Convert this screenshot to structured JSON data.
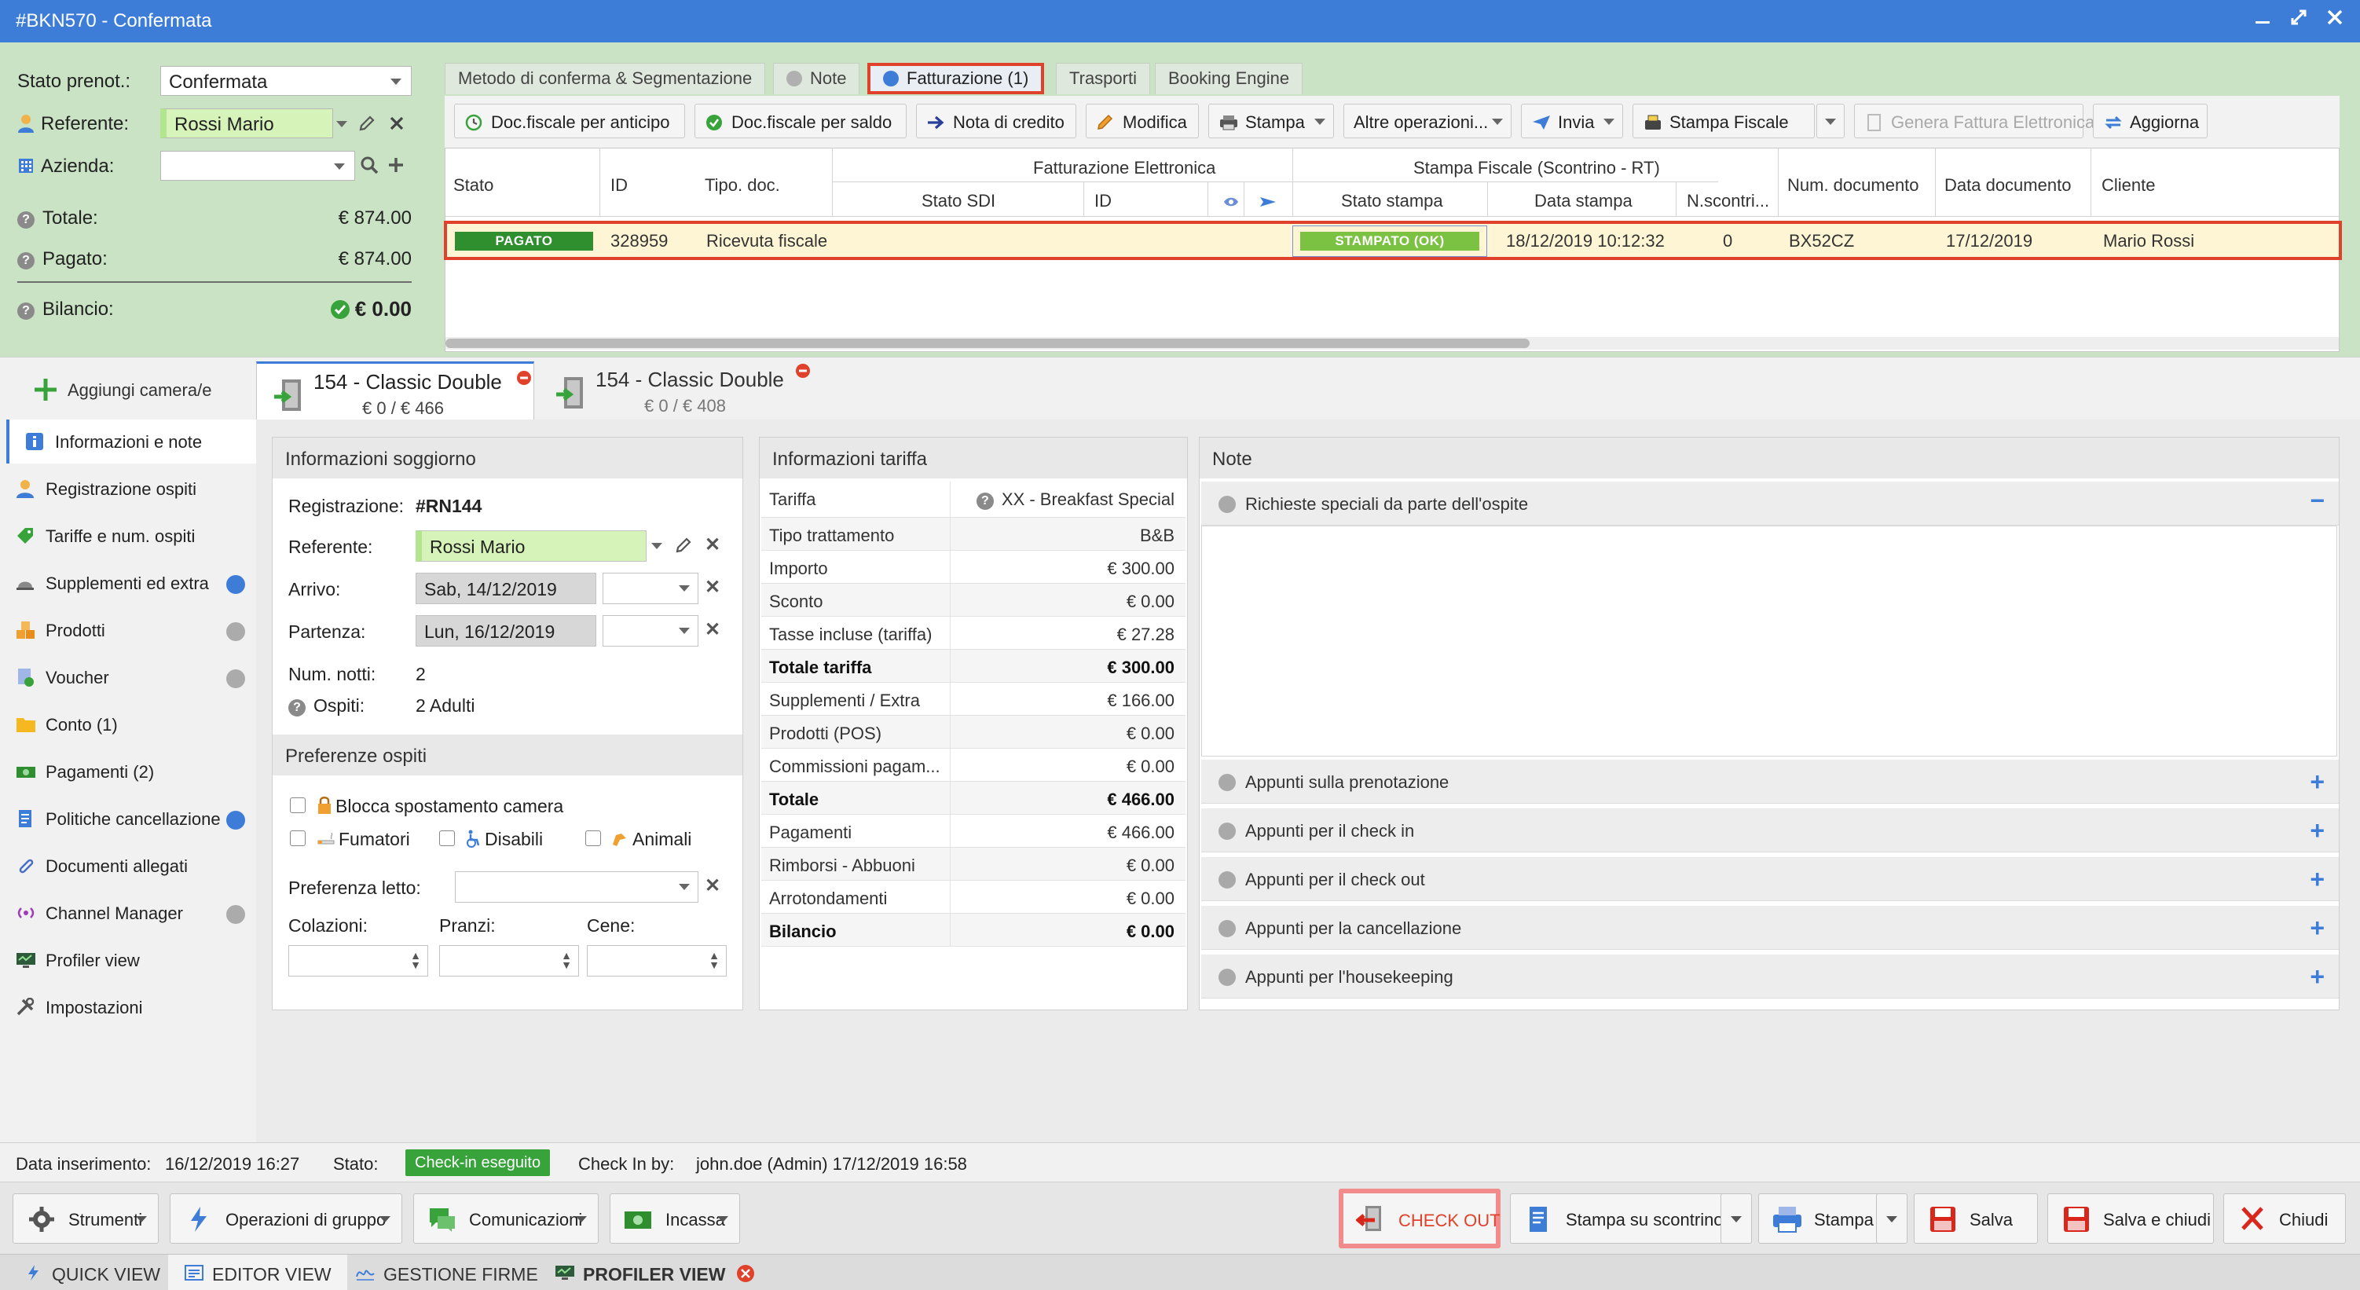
{
  "window": {
    "title": "#BKN570 - Confermata"
  },
  "header": {
    "stato_label": "Stato prenot.:",
    "stato_value": "Confermata",
    "referente_label": "Referente:",
    "referente_value": "Rossi Mario",
    "azienda_label": "Azienda:",
    "azienda_value": "",
    "totale_label": "Totale:",
    "totale_value": "€ 874.00",
    "pagato_label": "Pagato:",
    "pagato_value": "€ 874.00",
    "bilancio_label": "Bilancio:",
    "bilancio_value": "€ 0.00"
  },
  "top_tabs": [
    {
      "label": "Metodo di conferma & Segmentazione"
    },
    {
      "label": "Note"
    },
    {
      "label": "Fatturazione (1)"
    },
    {
      "label": "Trasporti"
    },
    {
      "label": "Booking Engine"
    }
  ],
  "toolbar": {
    "doc_anticipo": "Doc.fiscale per anticipo",
    "doc_saldo": "Doc.fiscale per saldo",
    "nota_credito": "Nota di credito",
    "modifica": "Modifica",
    "stampa": "Stampa",
    "altre": "Altre operazioni...",
    "invia": "Invia",
    "stampa_fiscale": "Stampa Fiscale",
    "genera_fattura": "Genera Fattura Elettronica",
    "aggiorna": "Aggiorna"
  },
  "grid": {
    "group_fe": "Fatturazione Elettronica",
    "group_sf": "Stampa Fiscale (Scontrino - RT)",
    "col_stato": "Stato",
    "col_id": "ID",
    "col_tipo": "Tipo. doc.",
    "col_sdi": "Stato SDI",
    "col_fe_id": "ID",
    "col_stato_stampa": "Stato stampa",
    "col_data_stampa": "Data stampa",
    "col_nscontri": "N.scontri...",
    "col_num_doc": "Num. documento",
    "col_data_doc": "Data documento",
    "col_cliente": "Cliente",
    "row": {
      "stato": "PAGATO",
      "id": "328959",
      "tipo": "Ricevuta fiscale",
      "stato_stampa": "STAMPATO (OK)",
      "data_stampa": "18/12/2019 10:12:32",
      "nscontri": "0",
      "num_doc": "BX52CZ",
      "data_doc": "17/12/2019",
      "cliente": "Mario Rossi"
    }
  },
  "rooms": {
    "add_label": "Aggiungi camera/e",
    "tabs": [
      {
        "name": "154 - Classic Double",
        "amount": "€ 0 / € 466"
      },
      {
        "name": "154 - Classic Double",
        "amount": "€ 0 / € 408"
      }
    ]
  },
  "sidenav": [
    {
      "label": "Informazioni e note"
    },
    {
      "label": "Registrazione ospiti"
    },
    {
      "label": "Tariffe e num. ospiti"
    },
    {
      "label": "Supplementi ed extra"
    },
    {
      "label": "Prodotti"
    },
    {
      "label": "Voucher"
    },
    {
      "label": "Conto (1)"
    },
    {
      "label": "Pagamenti (2)"
    },
    {
      "label": "Politiche cancellazione"
    },
    {
      "label": "Documenti allegati"
    },
    {
      "label": "Channel Manager"
    },
    {
      "label": "Profiler view"
    },
    {
      "label": "Impostazioni"
    }
  ],
  "soggiorno": {
    "title": "Informazioni soggiorno",
    "registrazione_label": "Registrazione:",
    "registrazione_value": "#RN144",
    "referente_label": "Referente:",
    "referente_value": "Rossi Mario",
    "arrivo_label": "Arrivo:",
    "arrivo_value": "Sab, 14/12/2019",
    "partenza_label": "Partenza:",
    "partenza_value": "Lun, 16/12/2019",
    "notti_label": "Num. notti:",
    "notti_value": "2",
    "ospiti_label": "Ospiti:",
    "ospiti_value": "2 Adulti",
    "pref_title": "Preferenze ospiti",
    "blocca": "Blocca spostamento camera",
    "fumatori": "Fumatori",
    "disabili": "Disabili",
    "animali": "Animali",
    "letto_label": "Preferenza letto:",
    "colazioni_label": "Colazioni:",
    "pranzi_label": "Pranzi:",
    "cene_label": "Cene:"
  },
  "tariffa": {
    "title": "Informazioni tariffa",
    "rows": [
      {
        "k": "Tariffa",
        "v": "XX - Breakfast Special"
      },
      {
        "k": "Tipo trattamento",
        "v": "B&B"
      },
      {
        "k": "Importo",
        "v": "€ 300.00"
      },
      {
        "k": "Sconto",
        "v": "€ 0.00"
      },
      {
        "k": "Tasse incluse (tariffa)",
        "v": "€ 27.28"
      },
      {
        "k": "Totale tariffa",
        "v": "€ 300.00"
      },
      {
        "k": "Supplementi / Extra",
        "v": "€ 166.00"
      },
      {
        "k": "Prodotti (POS)",
        "v": "€ 0.00"
      },
      {
        "k": "Commissioni pagam...",
        "v": "€ 0.00"
      },
      {
        "k": "Totale",
        "v": "€ 466.00"
      },
      {
        "k": "Pagamenti",
        "v": "€ 466.00"
      },
      {
        "k": "Rimborsi - Abbuoni",
        "v": "€ 0.00"
      },
      {
        "k": "Arrotondamenti",
        "v": "€ 0.00"
      },
      {
        "k": "Bilancio",
        "v": "€ 0.00"
      }
    ]
  },
  "note": {
    "title": "Note",
    "richieste": "Richieste speciali da parte dell'ospite",
    "sections": [
      {
        "label": "Appunti sulla prenotazione"
      },
      {
        "label": "Appunti per il check in"
      },
      {
        "label": "Appunti per il check out"
      },
      {
        "label": "Appunti per la cancellazione"
      },
      {
        "label": "Appunti per l'housekeeping"
      }
    ]
  },
  "status": {
    "inserimento_label": "Data inserimento:",
    "inserimento_value": "16/12/2019 16:27",
    "stato_label": "Stato:",
    "stato_value": "Check-in eseguito",
    "checkin_label": "Check In by:",
    "checkin_value": "john.doe (Admin) 17/12/2019 16:58"
  },
  "actions": {
    "strumenti": "Strumenti",
    "operazioni": "Operazioni di gruppo",
    "comunicazioni": "Comunicazioni",
    "incassa": "Incassa",
    "checkout": "CHECK OUT",
    "stampa_scontrino": "Stampa su scontrino",
    "stampa": "Stampa",
    "salva": "Salva",
    "salva_chiudi": "Salva e chiudi",
    "chiudi": "Chiudi"
  },
  "bottom_tabs": [
    {
      "label": "QUICK VIEW"
    },
    {
      "label": "EDITOR VIEW"
    },
    {
      "label": "GESTIONE FIRME"
    },
    {
      "label": "PROFILER VIEW"
    }
  ],
  "colors": {
    "accent": "#3d7dd8",
    "header_green": "#c9e3c4",
    "badge_green": "#2f8f2f",
    "highlight_red": "#e0412a",
    "row_yellow": "#fdf5d3"
  }
}
